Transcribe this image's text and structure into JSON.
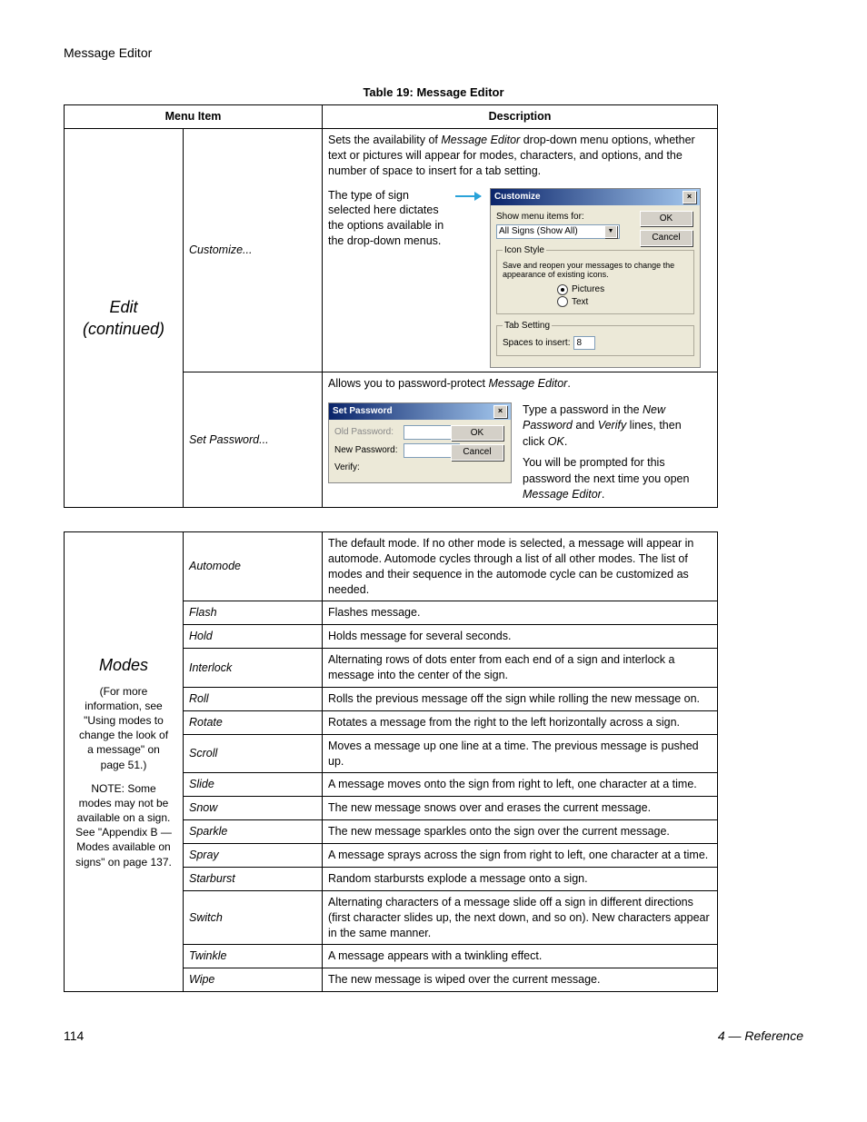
{
  "page_header": "Message Editor",
  "table_title": "Table 19: Message Editor",
  "columns": {
    "menu": "Menu Item",
    "desc": "Description"
  },
  "edit_section": {
    "heading_line1": "Edit",
    "heading_line2": "(continued)",
    "customize": {
      "item": "Customize...",
      "desc_intro_1": "Sets the availability of ",
      "desc_intro_italic": "Message Editor",
      "desc_intro_2": " drop-down menu options, whether text or pictures will appear for modes, characters, and options, and the number of space to insert for a tab setting.",
      "side_text": "The type of sign selected here dictates the options available in the drop-down menus.",
      "dialog": {
        "title": "Customize",
        "ok": "OK",
        "cancel": "Cancel",
        "show_label": "Show menu items for:",
        "select_value": "All Signs (Show All)",
        "fs_icon": {
          "legend": "Icon Style",
          "hint": "Save and reopen your messages to change the appearance of existing icons.",
          "radio_pictures": "Pictures",
          "radio_text": "Text"
        },
        "fs_tab": {
          "legend": "Tab Setting",
          "spaces_label": "Spaces to insert:",
          "spaces_value": "8"
        }
      }
    },
    "setpassword": {
      "item": "Set Password...",
      "desc_intro_1": "Allows you to password-protect ",
      "desc_intro_italic": "Message Editor",
      "desc_intro_2": ".",
      "side1_a": "Type a password in the ",
      "side1_i1": "New Password",
      "side1_b": " and ",
      "side1_i2": "Verify",
      "side1_c": " lines, then click ",
      "side1_i3": "OK",
      "side1_d": ".",
      "side2_a": "You will be prompted for this password the next time you open ",
      "side2_i": "Message Editor",
      "side2_b": ".",
      "dialog": {
        "title": "Set Password",
        "ok": "OK",
        "cancel": "Cancel",
        "old": "Old Password:",
        "new": "New Password:",
        "verify": "Verify:"
      }
    }
  },
  "modes_section": {
    "heading": "Modes",
    "note1": "(For more information, see \"Using modes to change the look of a message\" on page 51.)",
    "note2": "NOTE: Some modes may not be available on a sign. See \"Appendix B — Modes available on signs\" on page 137.",
    "rows": [
      {
        "item": "Automode",
        "desc": "The default mode. If no other mode is selected, a message will appear in automode. Automode cycles through a list of all other modes. The list of modes and their sequence in the automode cycle can be customized as needed."
      },
      {
        "item": "Flash",
        "desc": "Flashes message."
      },
      {
        "item": "Hold",
        "desc": "Holds message for several seconds."
      },
      {
        "item": "Interlock",
        "desc": "Alternating rows of dots enter from each end of a sign and interlock a message into the center of the sign."
      },
      {
        "item": "Roll",
        "desc": "Rolls the previous message off the sign while rolling the new message on."
      },
      {
        "item": "Rotate",
        "desc": "Rotates a message from the right to the left horizontally across a sign."
      },
      {
        "item": "Scroll",
        "desc": "Moves a message up one line at a time. The previous message is pushed up."
      },
      {
        "item": "Slide",
        "desc": "A message moves onto the sign from right to left, one character at a time."
      },
      {
        "item": "Snow",
        "desc": "The new message snows over and erases the current message."
      },
      {
        "item": "Sparkle",
        "desc": "The new message sparkles onto the sign over the current message."
      },
      {
        "item": "Spray",
        "desc": "A message sprays across the sign from right to left, one character at a time."
      },
      {
        "item": "Starburst",
        "desc": "Random starbursts explode a message onto a sign."
      },
      {
        "item": "Switch",
        "desc": "Alternating characters of a message slide off a sign in different directions (first character slides up, the next down, and so on). New characters appear in the same manner."
      },
      {
        "item": "Twinkle",
        "desc": "A message appears with a twinkling effect."
      },
      {
        "item": "Wipe",
        "desc": "The new message is wiped over the current message."
      }
    ]
  },
  "footer": {
    "page": "114",
    "section": "4 — Reference"
  }
}
